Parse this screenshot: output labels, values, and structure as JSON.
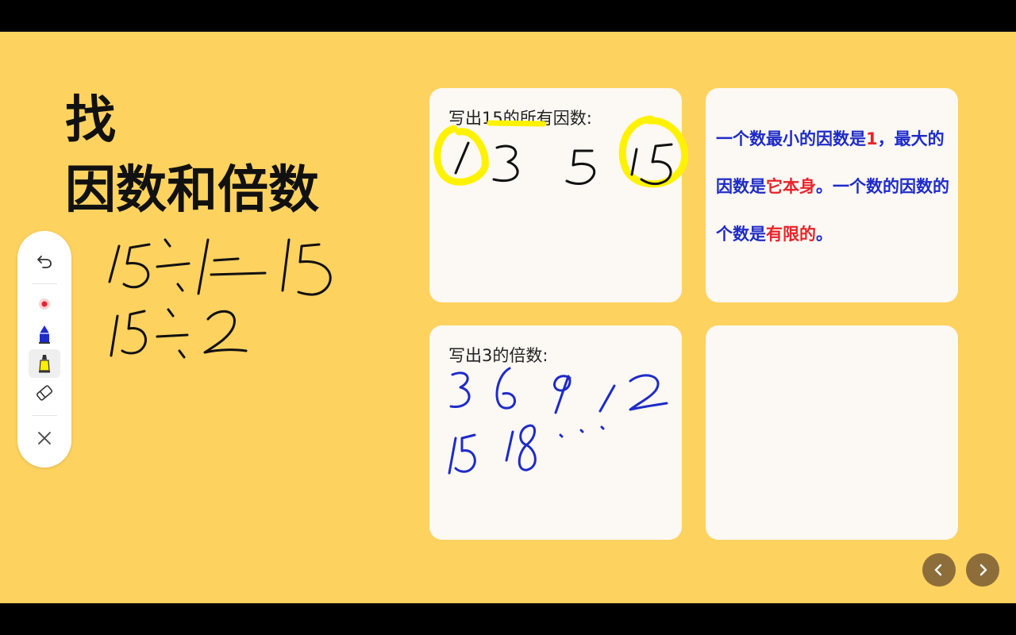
{
  "slide": {
    "title_line1": "找",
    "title_line2": "因数和倍数"
  },
  "cards": {
    "factors_prompt": "写出15的所有因数:",
    "multiples_prompt": "写出3的倍数:",
    "fact": {
      "p1": "一个数最小的因数是",
      "p2": "1",
      "p3": "，最大的因数是",
      "p4": "它本身",
      "p5": "。一个数的因数的个数是",
      "p6": "有限的",
      "p7": "。"
    }
  },
  "toolbar": {
    "icons": [
      "undo-icon",
      "laser-pointer-icon",
      "pen-icon",
      "highlighter-icon",
      "eraser-icon",
      "close-icon"
    ],
    "laser_color": "#E8242B",
    "pen_color": "#1E2BC9",
    "highlighter_color": "#FFEE00"
  },
  "colors": {
    "background": "#FED25F",
    "card": "#FCF8F3",
    "ink_black": "#111111",
    "ink_blue": "#1E2BC9",
    "highlight": "#FFF200",
    "nav_button": "#8D6E3A"
  }
}
